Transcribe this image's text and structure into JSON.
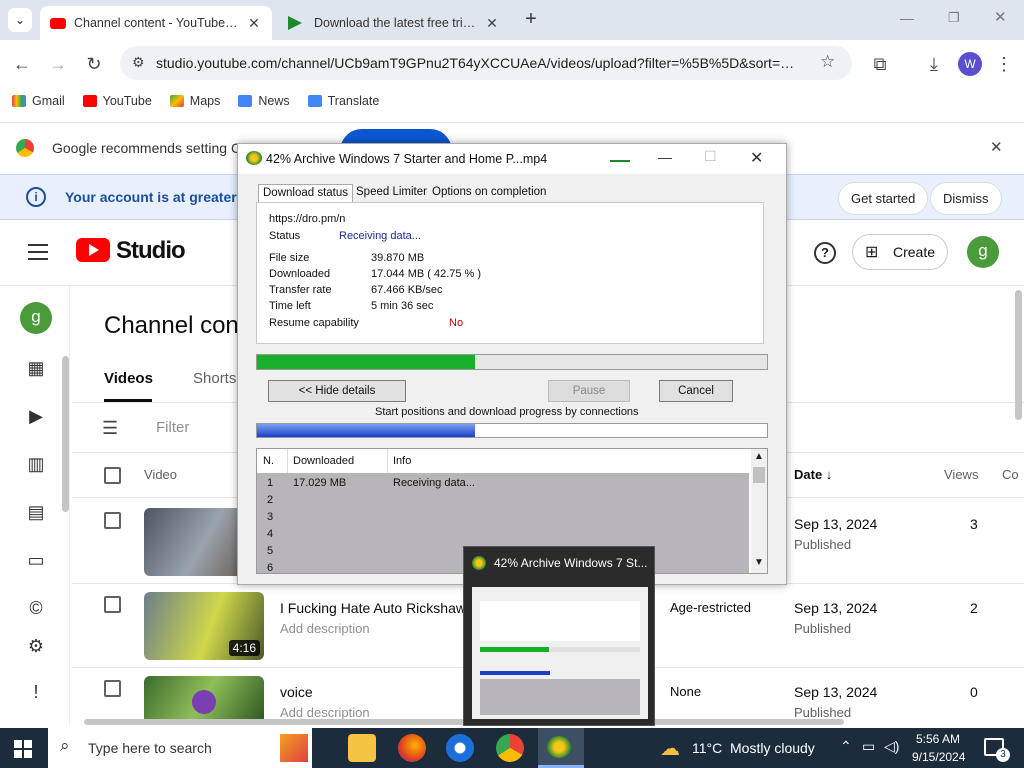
{
  "browser": {
    "tabs": [
      {
        "title": "Channel content - YouTube Stu",
        "active": true
      },
      {
        "title": "Download the latest free trial v",
        "active": false
      }
    ],
    "url": "studio.youtube.com/channel/UCb9amT9GPnu2T64yXCCUAeA/videos/upload?filter=%5B%5D&sort=%7...",
    "profile_letter": "W",
    "bookmarks": [
      "Gmail",
      "YouTube",
      "Maps",
      "News",
      "Translate"
    ]
  },
  "infobar": {
    "text": "Google recommends setting Chr"
  },
  "account_bar": {
    "text": "Your account is at greater risk",
    "get_started": "Get started",
    "dismiss": "Dismiss"
  },
  "studio": {
    "logo_text": "Studio",
    "create_label": "Create",
    "avatar_letter": "g",
    "page_title": "Channel cont",
    "tabs": [
      "Videos",
      "Shorts"
    ],
    "filter_placeholder": "Filter",
    "columns": {
      "video": "Video",
      "date": "Date",
      "views": "Views",
      "comments": "Co"
    },
    "rows": [
      {
        "title": "",
        "desc": "",
        "visibility": "",
        "date": "Sep 13, 2024",
        "status": "Published",
        "views": "3",
        "duration": ""
      },
      {
        "title": "I Fucking Hate Auto Rickshaw",
        "desc": "Add description",
        "visibility": "Age-restricted",
        "date": "Sep 13, 2024",
        "status": "Published",
        "views": "2",
        "duration": "4:16"
      },
      {
        "title": "voice",
        "desc": "Add description",
        "visibility": "None",
        "date": "Sep 13, 2024",
        "status": "Published",
        "views": "0",
        "duration": ""
      }
    ]
  },
  "idm": {
    "title": "42% Archive Windows 7 Starter and Home P...mp4",
    "tabs": [
      "Download status",
      "Speed Limiter",
      "Options on completion"
    ],
    "url": "https://dro.pm/n",
    "fields": [
      {
        "k": "Status",
        "v": "Receiving data..."
      },
      {
        "k": "File size",
        "v": "39.870  MB"
      },
      {
        "k": "Downloaded",
        "v": "17.044  MB  ( 42.75 % )"
      },
      {
        "k": "Transfer rate",
        "v": "67.466  KB/sec"
      },
      {
        "k": "Time left",
        "v": "5 min 36 sec"
      },
      {
        "k": "Resume capability",
        "v": "No"
      }
    ],
    "progress": 0.4275,
    "hide_details": "<< Hide details",
    "pause": "Pause",
    "cancel": "Cancel",
    "connections_caption": "Start positions and download progress by connections",
    "conn_columns": [
      "N.",
      "Downloaded",
      "Info"
    ],
    "conn_rows": [
      {
        "n": "1",
        "downloaded": "17.029  MB",
        "info": "Receiving data..."
      },
      {
        "n": "2",
        "downloaded": "",
        "info": ""
      },
      {
        "n": "3",
        "downloaded": "",
        "info": ""
      },
      {
        "n": "4",
        "downloaded": "",
        "info": ""
      },
      {
        "n": "5",
        "downloaded": "",
        "info": ""
      },
      {
        "n": "6",
        "downloaded": "",
        "info": ""
      }
    ]
  },
  "preview": {
    "title": "42% Archive Windows 7 St..."
  },
  "taskbar": {
    "search_placeholder": "Type here to search",
    "weather_temp": "11°C",
    "weather_desc": "Mostly cloudy",
    "time": "5:56 AM",
    "date": "9/15/2024",
    "notifications": "3"
  }
}
